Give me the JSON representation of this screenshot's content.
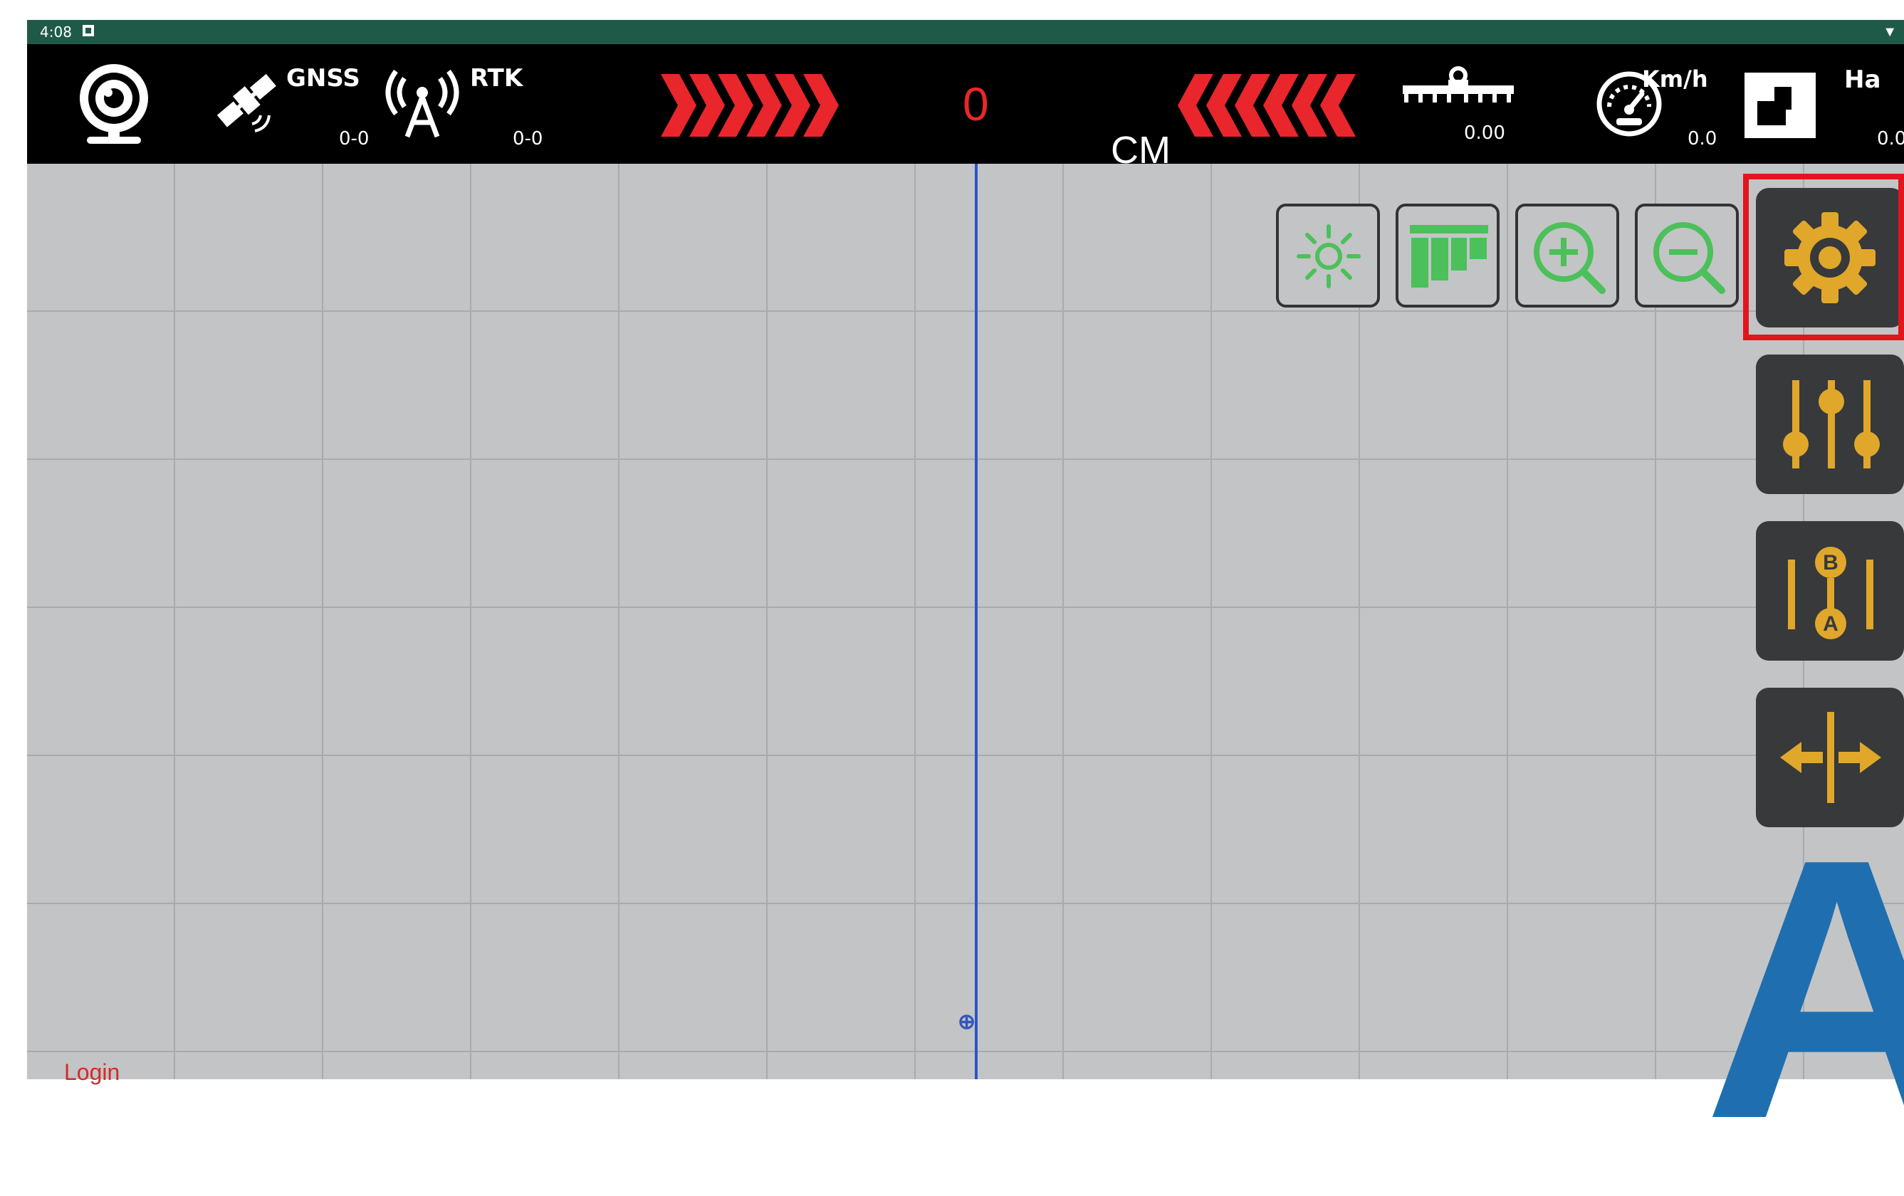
{
  "status_bar": {
    "time": "4:08"
  },
  "top_bar": {
    "gnss": {
      "label": "GNSS",
      "value": "0-0"
    },
    "rtk": {
      "label": "RTK",
      "value": "0-0"
    },
    "offset": {
      "value": "0",
      "unit": "CM"
    },
    "implement_width": {
      "value": "0.00"
    },
    "speed": {
      "label": "Km/h",
      "value": "0.0"
    },
    "area": {
      "label": "Ha",
      "value": "0.0"
    }
  },
  "map": {
    "login_link": "Login",
    "big_letter": "A"
  },
  "colors": {
    "accent": "#e8262b",
    "tool_icon": "#4cc05a",
    "side_icon": "#e0a72a",
    "highlight": "#e4141b",
    "guide_line": "#2b56c8",
    "letter": "#1f6fb0"
  },
  "icons": {
    "camera": "camera-icon",
    "satellite": "satellite-icon",
    "antenna": "antenna-icon",
    "implement": "implement-icon",
    "speedometer": "speedometer-icon",
    "area": "area-icon",
    "brightness": "brightness-icon",
    "sections": "sections-icon",
    "zoom_in": "zoom-in-icon",
    "zoom_out": "zoom-out-icon",
    "settings": "gear-icon",
    "adjust": "sliders-icon",
    "ab_line": "ab-line-icon",
    "shift": "shift-line-icon"
  }
}
